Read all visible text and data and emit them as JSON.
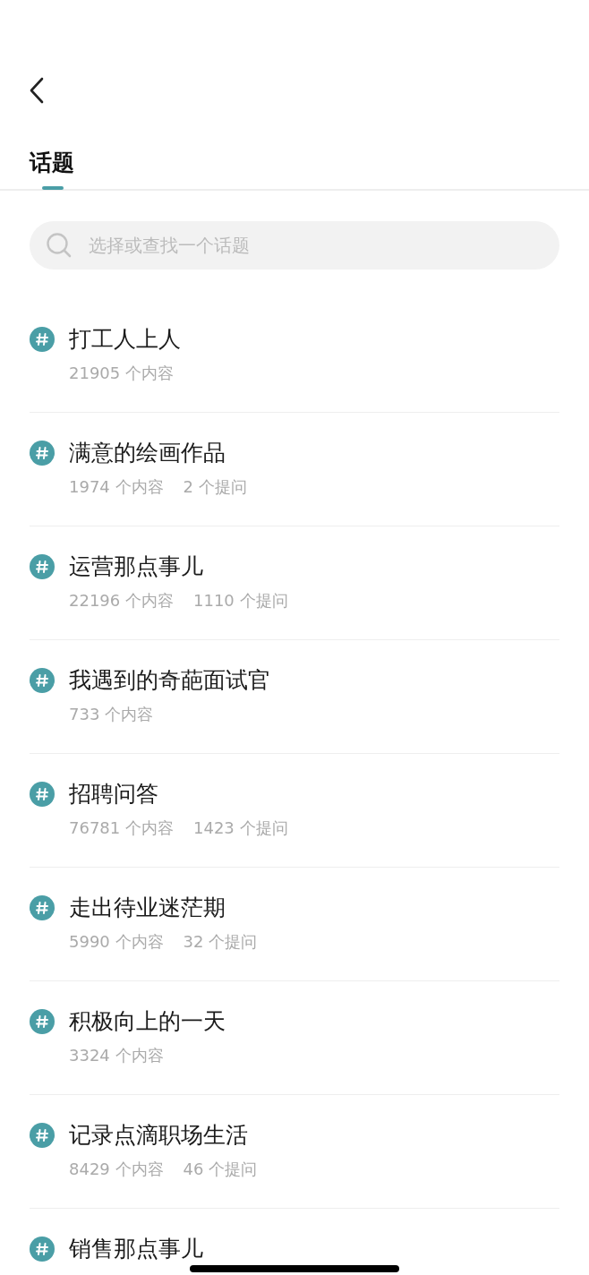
{
  "tabs": [
    {
      "label": "话题",
      "selected": true
    }
  ],
  "search": {
    "placeholder": "选择或查找一个话题"
  },
  "topics": [
    {
      "title": "打工人上人",
      "stats": [
        "21905 个内容"
      ]
    },
    {
      "title": "满意的绘画作品",
      "stats": [
        "1974 个内容",
        "2 个提问"
      ]
    },
    {
      "title": "运营那点事儿",
      "stats": [
        "22196 个内容",
        "1110 个提问"
      ]
    },
    {
      "title": "我遇到的奇葩面试官",
      "stats": [
        "733 个内容"
      ]
    },
    {
      "title": "招聘问答",
      "stats": [
        "76781 个内容",
        "1423 个提问"
      ]
    },
    {
      "title": "走出待业迷茫期",
      "stats": [
        "5990 个内容",
        "32 个提问"
      ]
    },
    {
      "title": "积极向上的一天",
      "stats": [
        "3324 个内容"
      ]
    },
    {
      "title": "记录点滴职场生活",
      "stats": [
        "8429 个内容",
        "46 个提问"
      ]
    },
    {
      "title": "销售那点事儿"
    }
  ]
}
